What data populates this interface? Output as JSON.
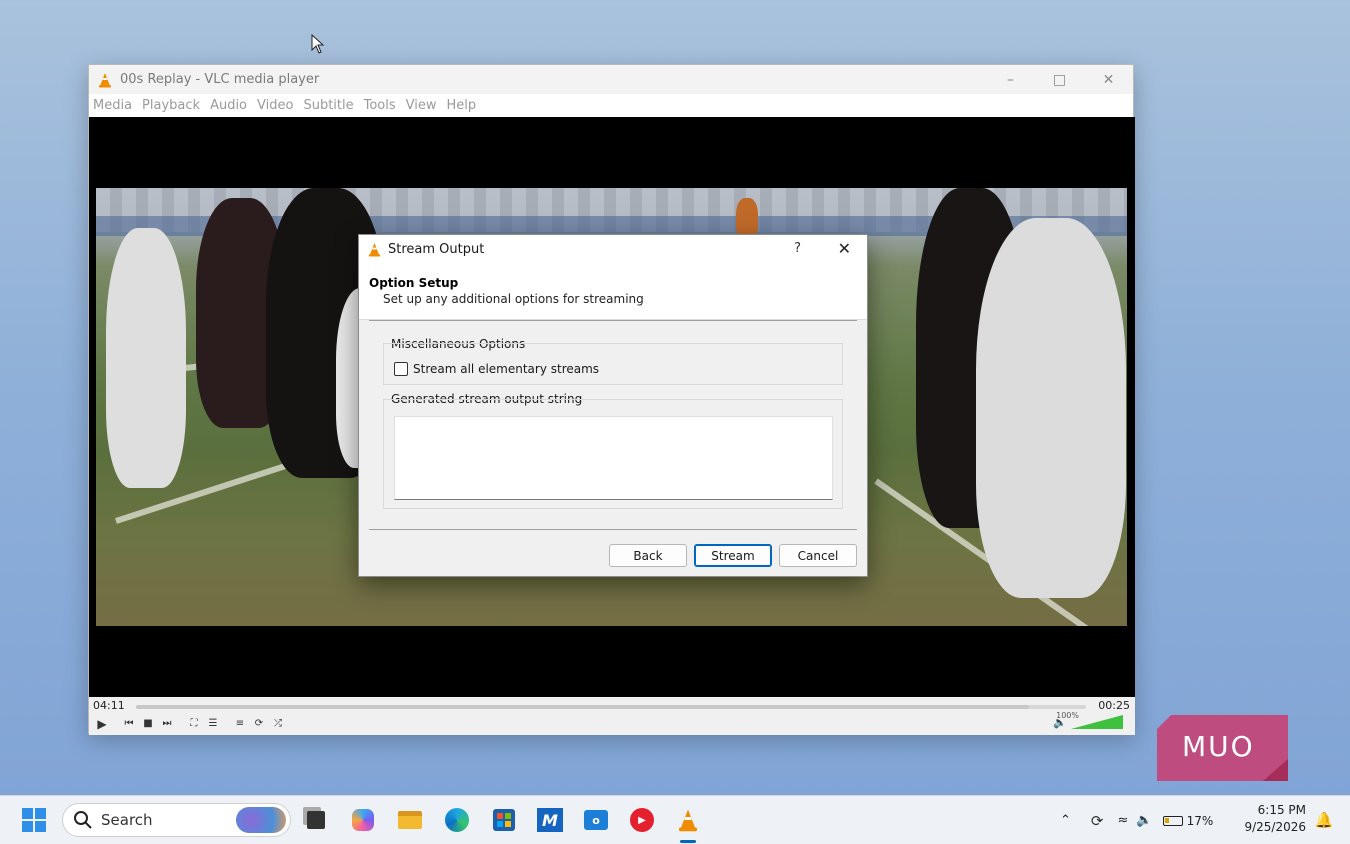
{
  "vlc": {
    "title": "00s Replay - VLC media player",
    "menu": [
      "Media",
      "Playback",
      "Audio",
      "Video",
      "Subtitle",
      "Tools",
      "View",
      "Help"
    ],
    "time_elapsed": "04:11",
    "time_remaining": "00:25",
    "volume_label": "100%",
    "volume_level": 1.0,
    "progress": 0.94
  },
  "dialog": {
    "title": "Stream Output",
    "help": "?",
    "header_title": "Option Setup",
    "header_subtitle": "Set up any additional options for streaming",
    "misc_group_label": "Miscellaneous Options",
    "checkbox_label": "Stream all elementary streams",
    "checkbox_checked": false,
    "output_group_label": "Generated stream output string",
    "output_value": "",
    "buttons": {
      "back": "Back",
      "stream": "Stream",
      "cancel": "Cancel"
    }
  },
  "watermark": "MUO",
  "taskbar": {
    "search_label": "Search",
    "battery": "17%",
    "time": "6:15 PM",
    "date": "9/25/2026",
    "pinned": [
      "file-explorer-icon",
      "edge-icon",
      "store-icon",
      "copilot-icon",
      "outlook-icon",
      "youtube-music-icon",
      "vlc-icon"
    ]
  },
  "colors": {
    "vlc_orange": "#f08c00",
    "accent_blue": "#0067c0",
    "muo_pink": "#c93c6e"
  }
}
